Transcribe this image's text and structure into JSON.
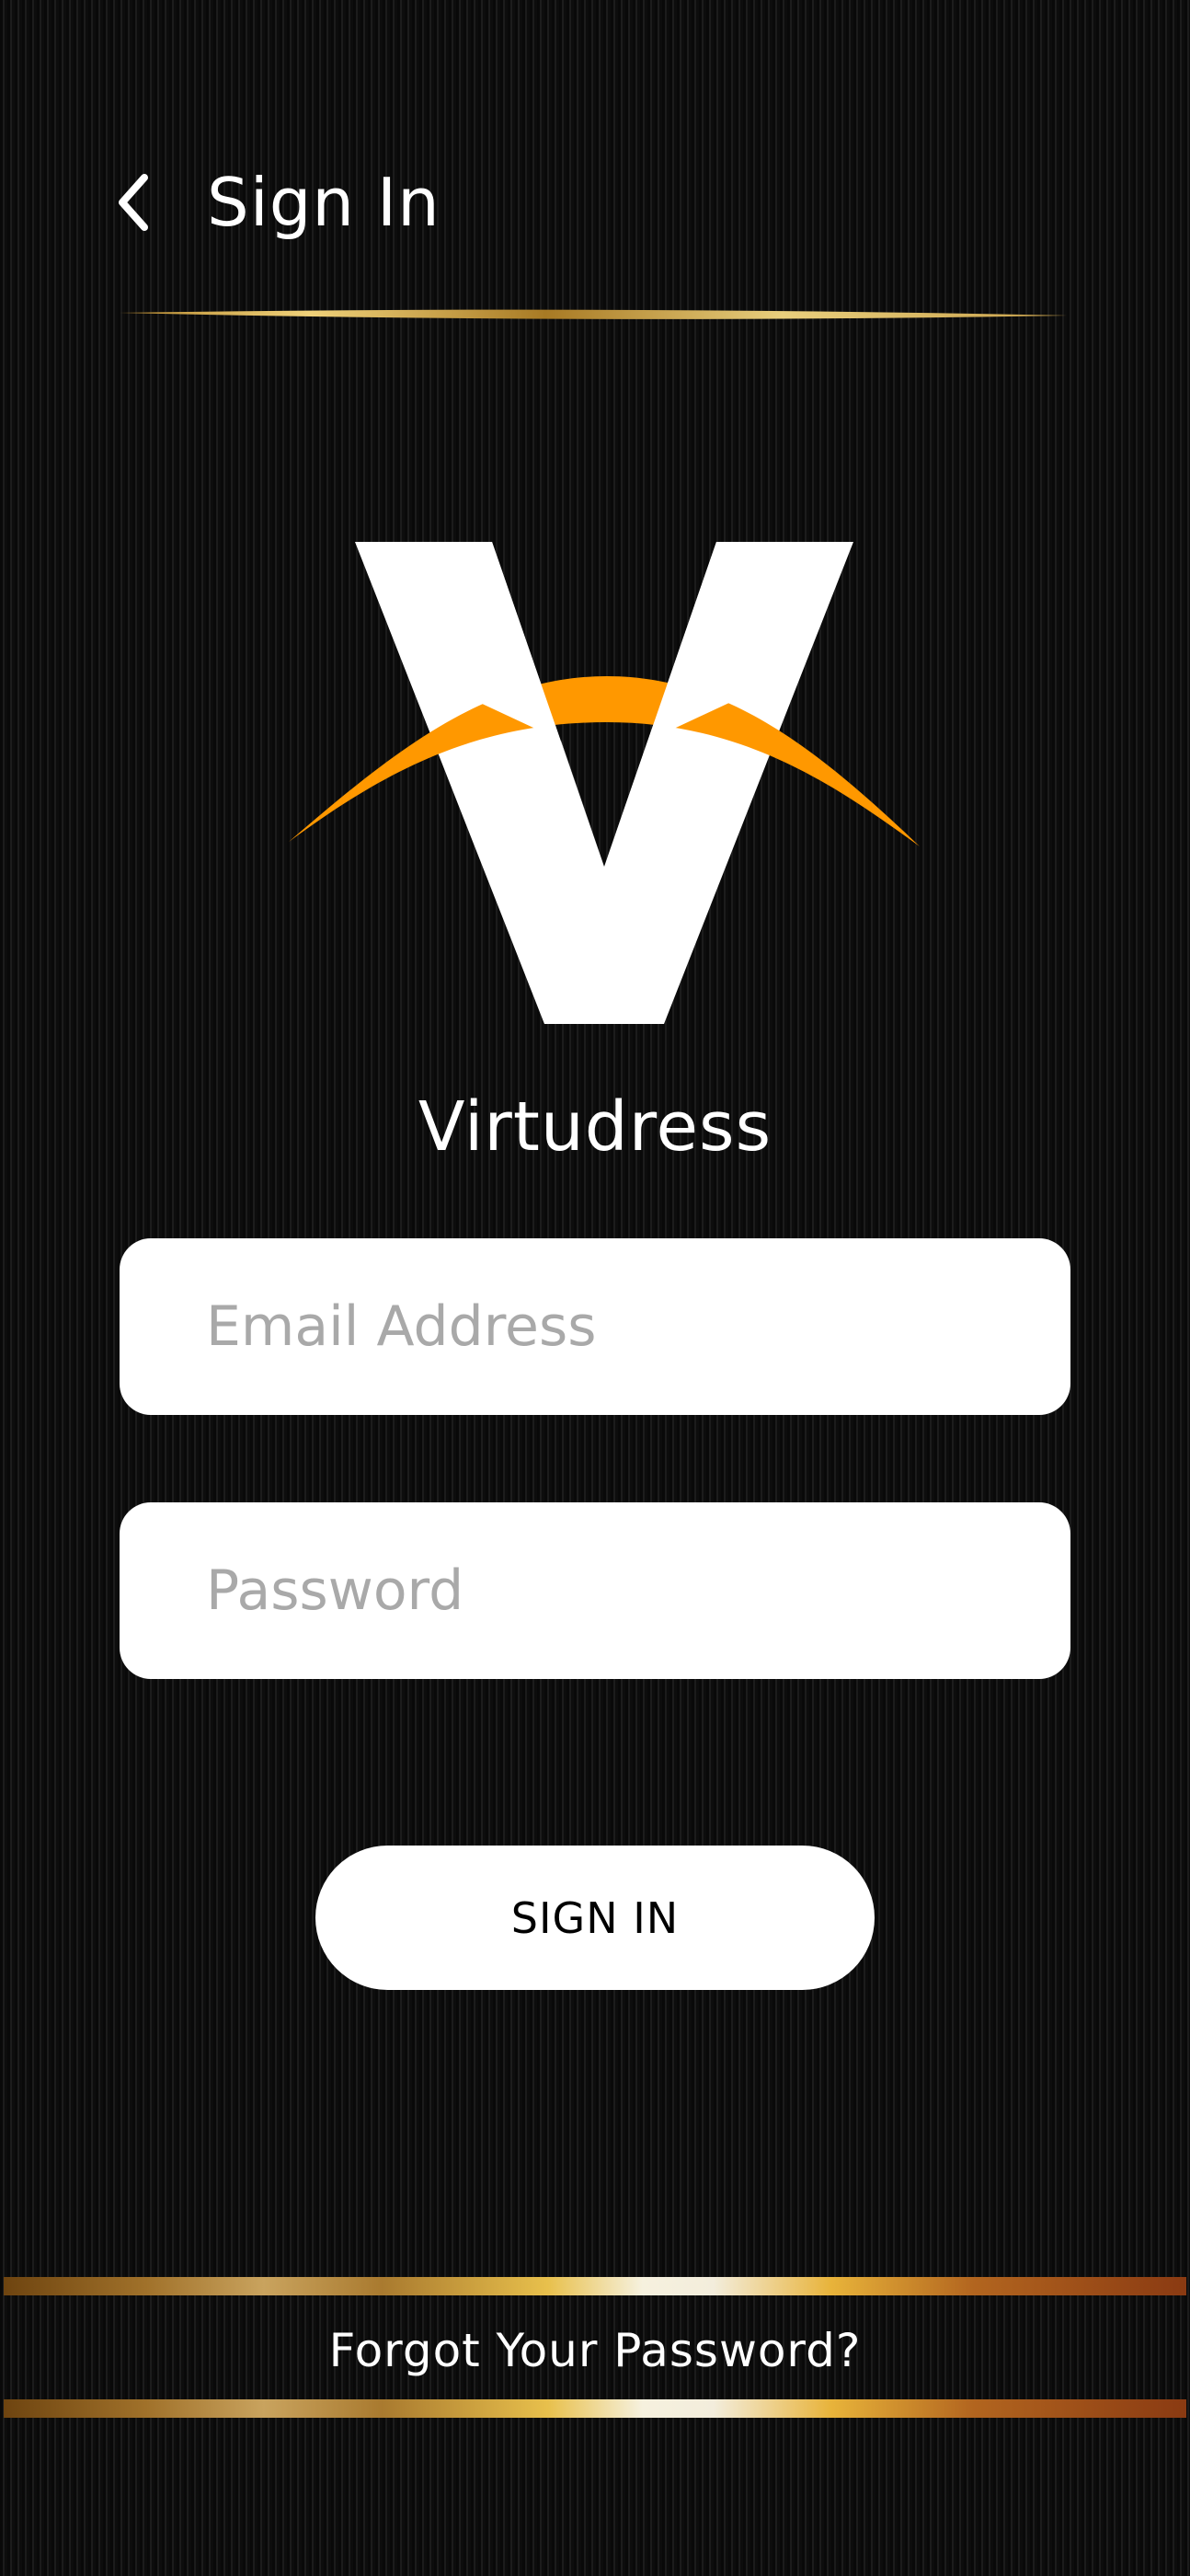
{
  "header": {
    "back_icon": "chevron-left-icon",
    "title": "Sign In"
  },
  "brand": {
    "logo_icon": "virtudress-logo",
    "name": "Virtudress",
    "accent_color": "#ff9800"
  },
  "form": {
    "email": {
      "value": "",
      "placeholder": "Email Address"
    },
    "password": {
      "value": "",
      "placeholder": "Password"
    },
    "submit_label": "SIGN IN"
  },
  "footer": {
    "forgot_label": "Forgot Your Password?"
  },
  "colors": {
    "background": "#0b0b0b",
    "field_background": "#ffffff",
    "placeholder": "#a9a9a9",
    "gold": "#e8c04c"
  }
}
